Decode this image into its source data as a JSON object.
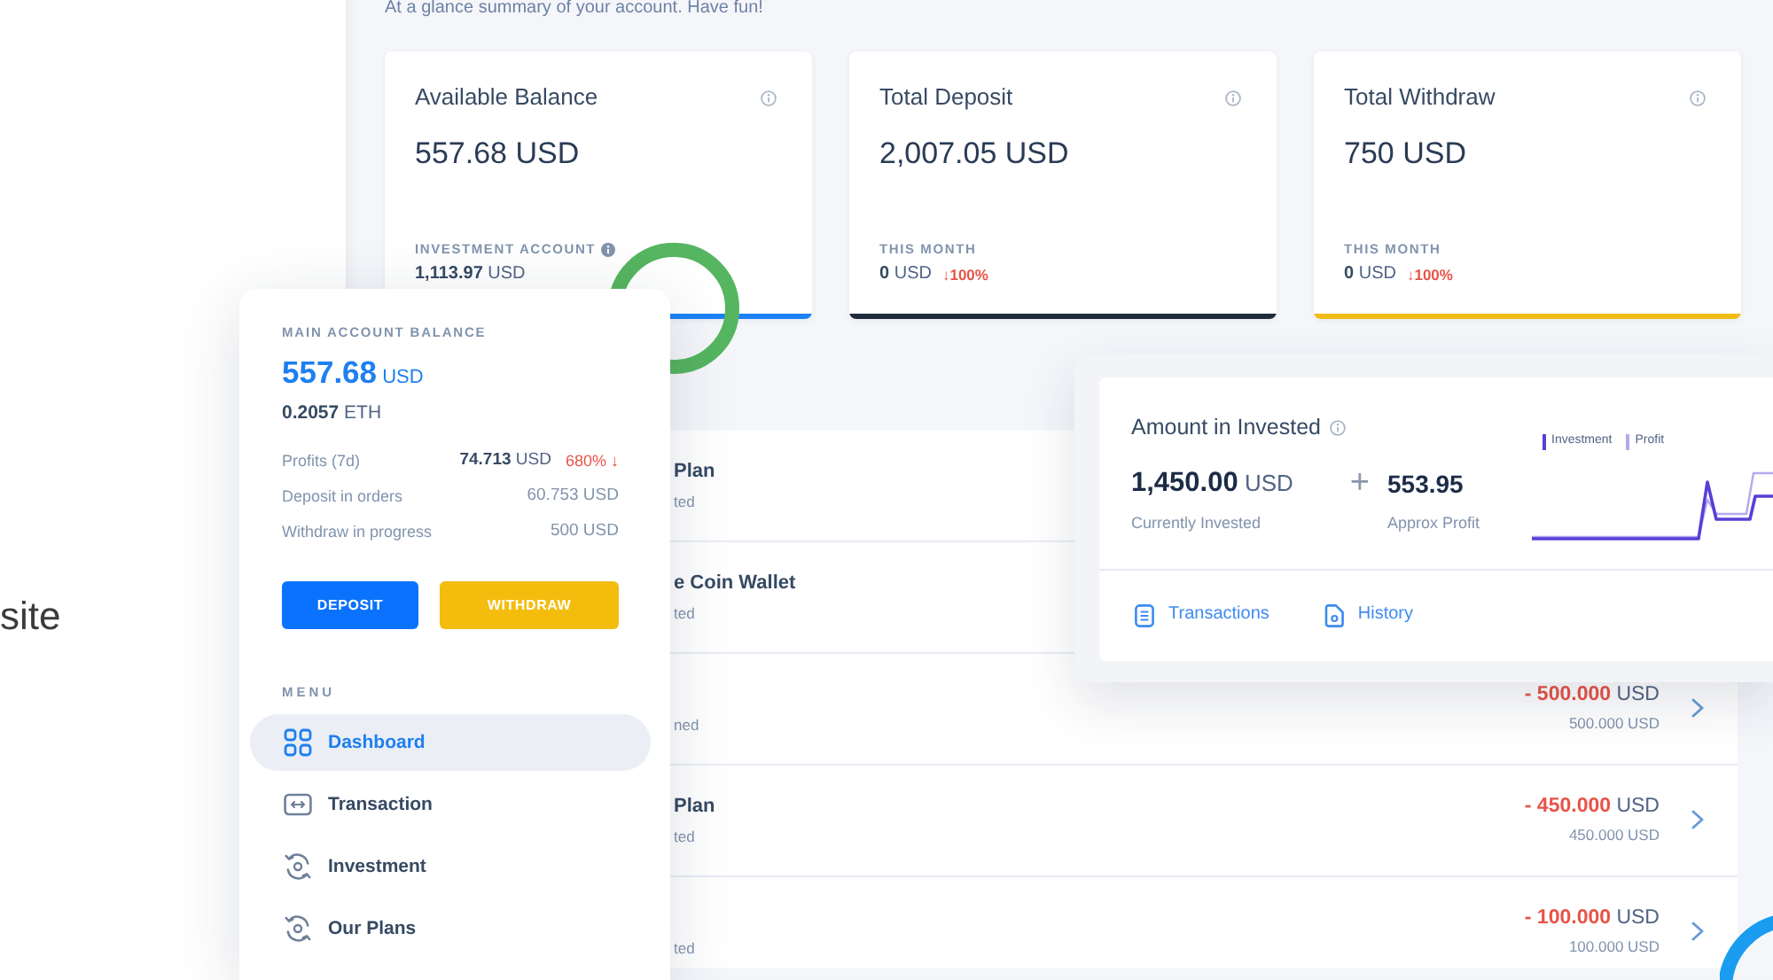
{
  "intro": {
    "text": "site"
  },
  "dashboard": {
    "subtitle": "At a glance summary of your account. Have fun!",
    "stat_cards": [
      {
        "title": "Available Balance",
        "amount": "557.68 USD",
        "footer_label": "INVESTMENT ACCOUNT",
        "footer_info": true,
        "footer_value": "**1,113.97** USD",
        "color": "#1c83f5"
      },
      {
        "title": "Total Deposit",
        "amount": "2,007.05 USD",
        "footer_label": "THIS MONTH",
        "footer_info": false,
        "footer_value": "**0** USD",
        "change": "↓100%",
        "color": "#1f2a3c"
      },
      {
        "title": "Total Withdraw",
        "amount": "750 USD",
        "footer_label": "THIS MONTH",
        "footer_info": false,
        "footer_value": "**0** USD",
        "change": "↓100%",
        "color": "#f2bc16"
      }
    ],
    "transactions": [
      {
        "title": "Plan",
        "subtitle": "ted"
      },
      {
        "title": "e Coin Wallet",
        "subtitle": "ted"
      },
      {
        "subtitle": "ned",
        "amount": "**- 500.000** USD",
        "sub_amount": "500.000 USD"
      },
      {
        "title": "Plan",
        "subtitle": "ted",
        "amount": "**- 450.000** USD",
        "sub_amount": "450.000 USD"
      },
      {
        "subtitle": "ted",
        "amount": "**- 100.000** USD",
        "sub_amount": "100.000 USD"
      }
    ]
  },
  "sidebar": {
    "balance_label": "MAIN ACCOUNT BALANCE",
    "balance": "**557.68** USD",
    "eth": "**0.2057** ETH",
    "stats": [
      {
        "label": "Profits (7d)",
        "value": "**74.713** USD",
        "change": "680% ↓",
        "kind": "highlight"
      },
      {
        "label": "Deposit in orders",
        "value": "60.753 USD",
        "kind": "plain"
      },
      {
        "label": "Withdraw in progress",
        "value": "500 USD",
        "kind": "plain"
      }
    ],
    "buttons": [
      {
        "label": "DEPOSIT",
        "kind": "primary"
      },
      {
        "label": "WITHDRAW",
        "kind": "warning"
      }
    ],
    "menu_label": "MENU",
    "menu": [
      {
        "label": "Dashboard",
        "kind": "grid",
        "selected": true
      },
      {
        "label": "Transaction",
        "kind": "transfer",
        "selected": false
      },
      {
        "label": "Investment",
        "kind": "cycle",
        "selected": false
      },
      {
        "label": "Our Plans",
        "kind": "cycle",
        "selected": false
      }
    ]
  },
  "invested_card": {
    "title": "Amount in Invested",
    "amount": "**1,450.00** USD",
    "amount_label": "Currently Invested",
    "plus": "+",
    "profit": "553.95",
    "profit_label": "Approx Profit",
    "sparkline": {
      "series": [
        {
          "name": "Investment",
          "color": "#5a3ed8"
        },
        {
          "name": "Profit",
          "color": "#b4a8ee"
        }
      ]
    },
    "links": [
      {
        "label": "Transactions",
        "kind": "list"
      },
      {
        "label": "History",
        "kind": "file"
      }
    ]
  }
}
